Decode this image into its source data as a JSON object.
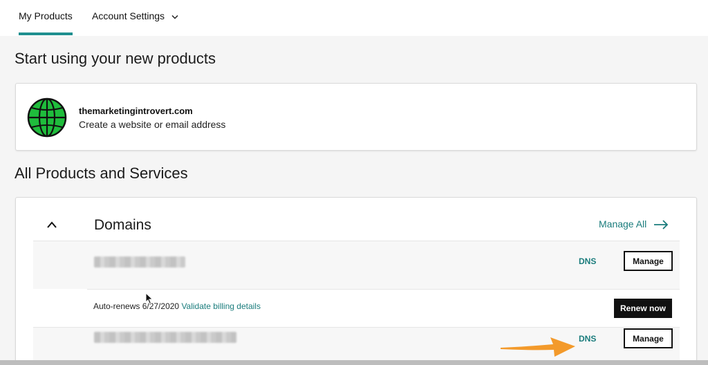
{
  "nav": {
    "tabs": [
      {
        "label": "My Products"
      },
      {
        "label": "Account Settings"
      }
    ]
  },
  "new_products": {
    "heading": "Start using your new products",
    "domain": "themarketingintrovert.com",
    "description": "Create a website or email address"
  },
  "all_products": {
    "heading": "All Products and Services",
    "section_title": "Domains",
    "manage_all_label": "Manage All",
    "rows": [
      {
        "dns_label": "DNS",
        "manage_label": "Manage"
      },
      {
        "dns_label": "DNS",
        "manage_label": "Manage"
      }
    ],
    "renewal": {
      "text": "Auto-renews 6/27/2020",
      "link": "Validate billing details",
      "button": "Renew now"
    }
  },
  "colors": {
    "accent": "#1a7c7c",
    "globe_fill": "#1fbd3c",
    "annotation_arrow": "#f39a2b"
  },
  "icons": [
    "globe-icon",
    "chevron-down-icon",
    "chevron-up-icon",
    "arrow-right-icon",
    "mouse-cursor-icon",
    "annotation-arrow-icon"
  ]
}
